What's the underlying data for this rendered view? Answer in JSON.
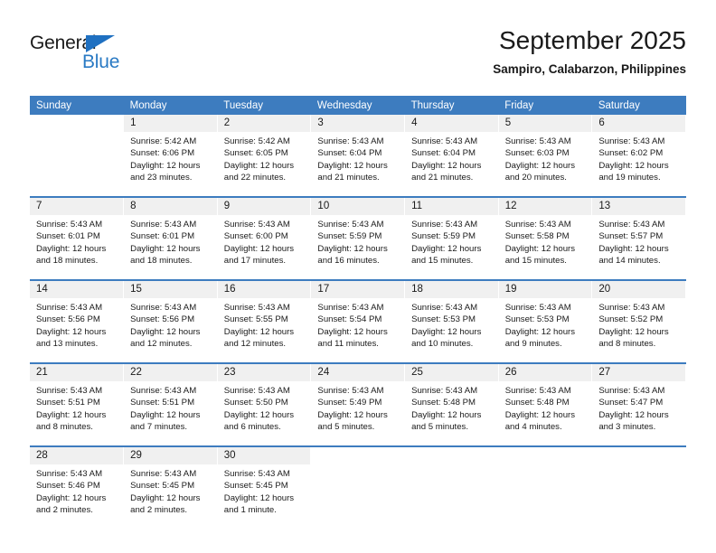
{
  "logo": {
    "text_primary": "General",
    "text_secondary": "Blue",
    "primary_color": "#1a1a1a",
    "secondary_color": "#2a7ac4",
    "triangle_color": "#1f70c1"
  },
  "header": {
    "title": "September 2025",
    "subtitle": "Sampiro, Calabarzon, Philippines",
    "header_bg_color": "#3d7cbf",
    "daynum_bg_color": "#f0f0f0"
  },
  "weekdays": [
    "Sunday",
    "Monday",
    "Tuesday",
    "Wednesday",
    "Thursday",
    "Friday",
    "Saturday"
  ],
  "weeks": [
    [
      {
        "day": "",
        "empty": true,
        "sunrise": "",
        "sunset": "",
        "daylight_line1": "",
        "daylight_line2": ""
      },
      {
        "day": "1",
        "sunrise": "Sunrise: 5:42 AM",
        "sunset": "Sunset: 6:06 PM",
        "daylight_line1": "Daylight: 12 hours",
        "daylight_line2": "and 23 minutes."
      },
      {
        "day": "2",
        "sunrise": "Sunrise: 5:42 AM",
        "sunset": "Sunset: 6:05 PM",
        "daylight_line1": "Daylight: 12 hours",
        "daylight_line2": "and 22 minutes."
      },
      {
        "day": "3",
        "sunrise": "Sunrise: 5:43 AM",
        "sunset": "Sunset: 6:04 PM",
        "daylight_line1": "Daylight: 12 hours",
        "daylight_line2": "and 21 minutes."
      },
      {
        "day": "4",
        "sunrise": "Sunrise: 5:43 AM",
        "sunset": "Sunset: 6:04 PM",
        "daylight_line1": "Daylight: 12 hours",
        "daylight_line2": "and 21 minutes."
      },
      {
        "day": "5",
        "sunrise": "Sunrise: 5:43 AM",
        "sunset": "Sunset: 6:03 PM",
        "daylight_line1": "Daylight: 12 hours",
        "daylight_line2": "and 20 minutes."
      },
      {
        "day": "6",
        "sunrise": "Sunrise: 5:43 AM",
        "sunset": "Sunset: 6:02 PM",
        "daylight_line1": "Daylight: 12 hours",
        "daylight_line2": "and 19 minutes."
      }
    ],
    [
      {
        "day": "7",
        "sunrise": "Sunrise: 5:43 AM",
        "sunset": "Sunset: 6:01 PM",
        "daylight_line1": "Daylight: 12 hours",
        "daylight_line2": "and 18 minutes."
      },
      {
        "day": "8",
        "sunrise": "Sunrise: 5:43 AM",
        "sunset": "Sunset: 6:01 PM",
        "daylight_line1": "Daylight: 12 hours",
        "daylight_line2": "and 18 minutes."
      },
      {
        "day": "9",
        "sunrise": "Sunrise: 5:43 AM",
        "sunset": "Sunset: 6:00 PM",
        "daylight_line1": "Daylight: 12 hours",
        "daylight_line2": "and 17 minutes."
      },
      {
        "day": "10",
        "sunrise": "Sunrise: 5:43 AM",
        "sunset": "Sunset: 5:59 PM",
        "daylight_line1": "Daylight: 12 hours",
        "daylight_line2": "and 16 minutes."
      },
      {
        "day": "11",
        "sunrise": "Sunrise: 5:43 AM",
        "sunset": "Sunset: 5:59 PM",
        "daylight_line1": "Daylight: 12 hours",
        "daylight_line2": "and 15 minutes."
      },
      {
        "day": "12",
        "sunrise": "Sunrise: 5:43 AM",
        "sunset": "Sunset: 5:58 PM",
        "daylight_line1": "Daylight: 12 hours",
        "daylight_line2": "and 15 minutes."
      },
      {
        "day": "13",
        "sunrise": "Sunrise: 5:43 AM",
        "sunset": "Sunset: 5:57 PM",
        "daylight_line1": "Daylight: 12 hours",
        "daylight_line2": "and 14 minutes."
      }
    ],
    [
      {
        "day": "14",
        "sunrise": "Sunrise: 5:43 AM",
        "sunset": "Sunset: 5:56 PM",
        "daylight_line1": "Daylight: 12 hours",
        "daylight_line2": "and 13 minutes."
      },
      {
        "day": "15",
        "sunrise": "Sunrise: 5:43 AM",
        "sunset": "Sunset: 5:56 PM",
        "daylight_line1": "Daylight: 12 hours",
        "daylight_line2": "and 12 minutes."
      },
      {
        "day": "16",
        "sunrise": "Sunrise: 5:43 AM",
        "sunset": "Sunset: 5:55 PM",
        "daylight_line1": "Daylight: 12 hours",
        "daylight_line2": "and 12 minutes."
      },
      {
        "day": "17",
        "sunrise": "Sunrise: 5:43 AM",
        "sunset": "Sunset: 5:54 PM",
        "daylight_line1": "Daylight: 12 hours",
        "daylight_line2": "and 11 minutes."
      },
      {
        "day": "18",
        "sunrise": "Sunrise: 5:43 AM",
        "sunset": "Sunset: 5:53 PM",
        "daylight_line1": "Daylight: 12 hours",
        "daylight_line2": "and 10 minutes."
      },
      {
        "day": "19",
        "sunrise": "Sunrise: 5:43 AM",
        "sunset": "Sunset: 5:53 PM",
        "daylight_line1": "Daylight: 12 hours",
        "daylight_line2": "and 9 minutes."
      },
      {
        "day": "20",
        "sunrise": "Sunrise: 5:43 AM",
        "sunset": "Sunset: 5:52 PM",
        "daylight_line1": "Daylight: 12 hours",
        "daylight_line2": "and 8 minutes."
      }
    ],
    [
      {
        "day": "21",
        "sunrise": "Sunrise: 5:43 AM",
        "sunset": "Sunset: 5:51 PM",
        "daylight_line1": "Daylight: 12 hours",
        "daylight_line2": "and 8 minutes."
      },
      {
        "day": "22",
        "sunrise": "Sunrise: 5:43 AM",
        "sunset": "Sunset: 5:51 PM",
        "daylight_line1": "Daylight: 12 hours",
        "daylight_line2": "and 7 minutes."
      },
      {
        "day": "23",
        "sunrise": "Sunrise: 5:43 AM",
        "sunset": "Sunset: 5:50 PM",
        "daylight_line1": "Daylight: 12 hours",
        "daylight_line2": "and 6 minutes."
      },
      {
        "day": "24",
        "sunrise": "Sunrise: 5:43 AM",
        "sunset": "Sunset: 5:49 PM",
        "daylight_line1": "Daylight: 12 hours",
        "daylight_line2": "and 5 minutes."
      },
      {
        "day": "25",
        "sunrise": "Sunrise: 5:43 AM",
        "sunset": "Sunset: 5:48 PM",
        "daylight_line1": "Daylight: 12 hours",
        "daylight_line2": "and 5 minutes."
      },
      {
        "day": "26",
        "sunrise": "Sunrise: 5:43 AM",
        "sunset": "Sunset: 5:48 PM",
        "daylight_line1": "Daylight: 12 hours",
        "daylight_line2": "and 4 minutes."
      },
      {
        "day": "27",
        "sunrise": "Sunrise: 5:43 AM",
        "sunset": "Sunset: 5:47 PM",
        "daylight_line1": "Daylight: 12 hours",
        "daylight_line2": "and 3 minutes."
      }
    ],
    [
      {
        "day": "28",
        "sunrise": "Sunrise: 5:43 AM",
        "sunset": "Sunset: 5:46 PM",
        "daylight_line1": "Daylight: 12 hours",
        "daylight_line2": "and 2 minutes."
      },
      {
        "day": "29",
        "sunrise": "Sunrise: 5:43 AM",
        "sunset": "Sunset: 5:45 PM",
        "daylight_line1": "Daylight: 12 hours",
        "daylight_line2": "and 2 minutes."
      },
      {
        "day": "30",
        "sunrise": "Sunrise: 5:43 AM",
        "sunset": "Sunset: 5:45 PM",
        "daylight_line1": "Daylight: 12 hours",
        "daylight_line2": "and 1 minute."
      },
      {
        "day": "",
        "empty": true,
        "sunrise": "",
        "sunset": "",
        "daylight_line1": "",
        "daylight_line2": ""
      },
      {
        "day": "",
        "empty": true,
        "sunrise": "",
        "sunset": "",
        "daylight_line1": "",
        "daylight_line2": ""
      },
      {
        "day": "",
        "empty": true,
        "sunrise": "",
        "sunset": "",
        "daylight_line1": "",
        "daylight_line2": ""
      },
      {
        "day": "",
        "empty": true,
        "sunrise": "",
        "sunset": "",
        "daylight_line1": "",
        "daylight_line2": ""
      }
    ]
  ]
}
